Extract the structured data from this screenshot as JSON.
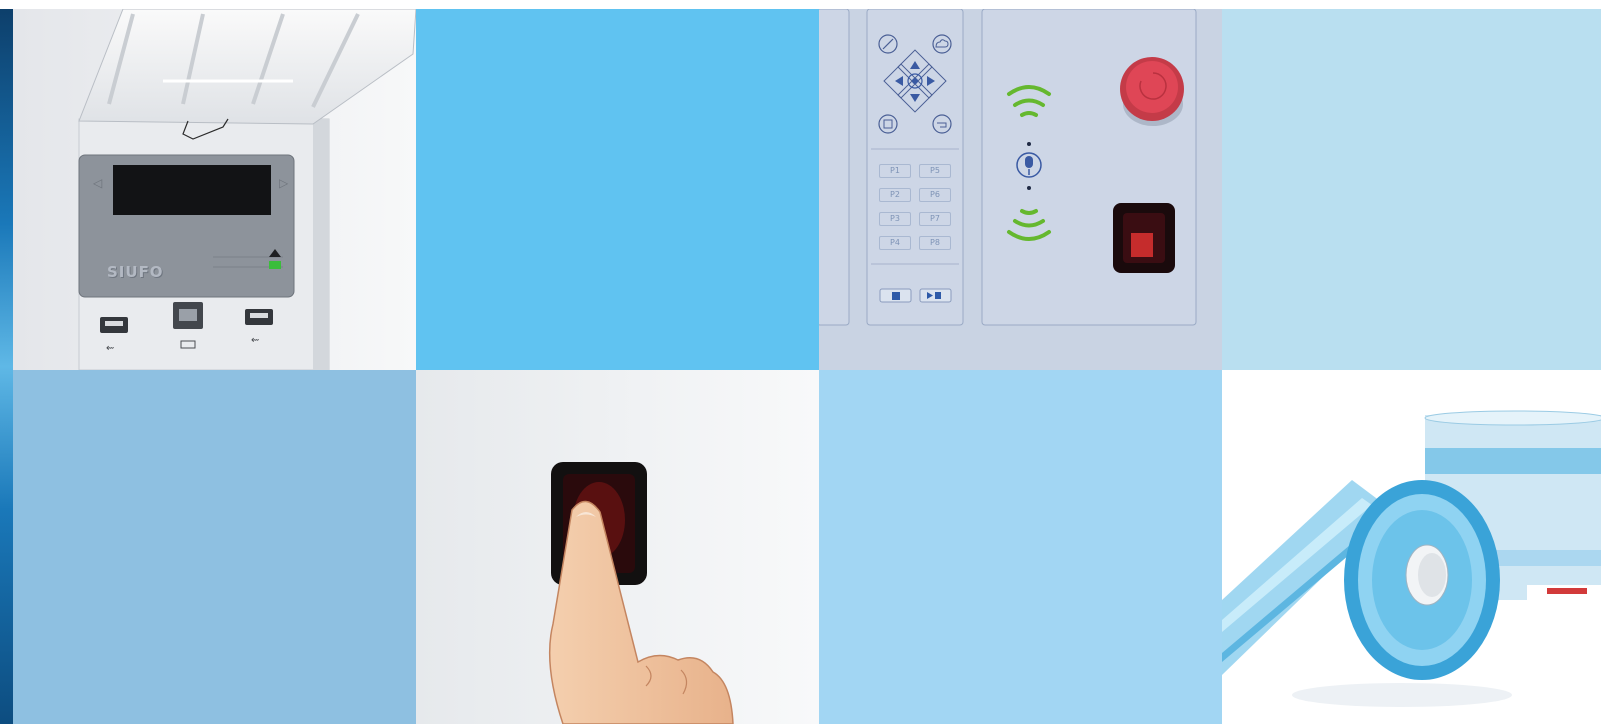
{
  "brand": {
    "label": "SIUFO"
  },
  "control_panel": {
    "program_buttons": [
      "P1",
      "P5",
      "P2",
      "P6",
      "P3",
      "P7",
      "P4",
      "P8"
    ]
  },
  "colors": {
    "sky_blue": "#60c3f1",
    "pale_blue": "#b9dff0",
    "steel_blue": "#8ec0e1",
    "light_blue": "#a2d6f3",
    "panel_bg": "#c9d3e3",
    "stripe": "#1a78b9"
  },
  "icons": [
    "edit-icon",
    "cloud-icon",
    "arrow-up-icon",
    "arrow-down-icon",
    "arrow-left-icon",
    "arrow-right-icon",
    "ok-icon",
    "save-icon",
    "back-icon",
    "door-icon",
    "play-pause-icon",
    "microphone-icon",
    "wireless-icon",
    "emergency-stop-icon",
    "fingerprint-sensor-icon",
    "usb-icon",
    "network-icon"
  ]
}
